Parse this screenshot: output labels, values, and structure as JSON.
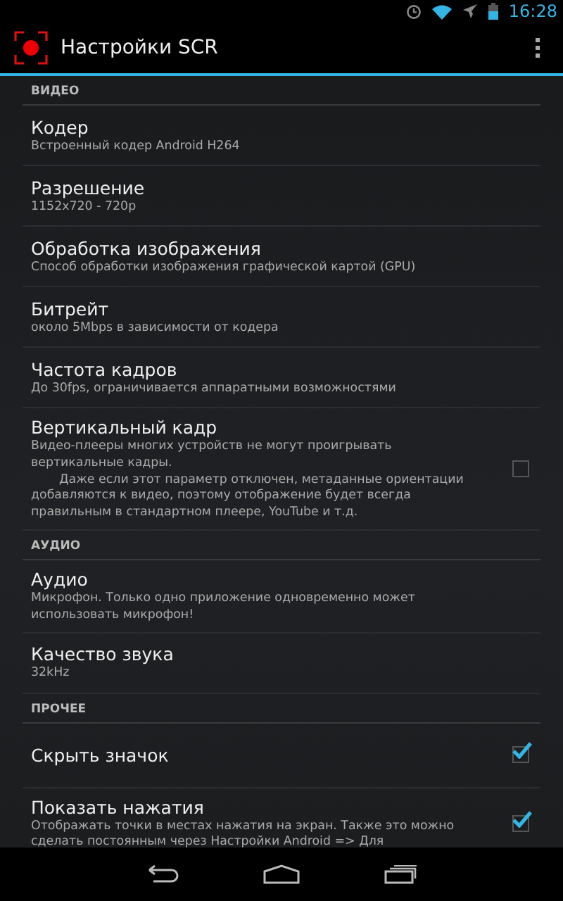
{
  "status_bar": {
    "time": "16:28"
  },
  "action_bar": {
    "title": "Настройки SCR"
  },
  "preferences": [
    {
      "kind": "header",
      "title": "ВИДЕО"
    },
    {
      "kind": "item",
      "title": "Кодер",
      "summary": [
        "Встроенный кодер Android H264"
      ]
    },
    {
      "kind": "item",
      "title": "Разрешение",
      "summary": [
        "1152x720 - 720p"
      ]
    },
    {
      "kind": "item",
      "title": "Обработка изображения",
      "summary": [
        "Способ обработки изображения графической картой (GPU)"
      ]
    },
    {
      "kind": "item",
      "title": "Битрейт",
      "summary": [
        "около 5Mbps в зависимости от кодера"
      ]
    },
    {
      "kind": "item",
      "title": "Частота кадров",
      "summary": [
        "До 30fps, ограничивается аппаратными возможностями"
      ]
    },
    {
      "kind": "check",
      "title": "Вертикальный кадр",
      "checked": false,
      "summary": [
        "Видео-плееры многих устройств не могут проигрывать вертикальные кадры.",
        "Даже если этот параметр отключен, метаданные ориентации добавляются к видео, поэтому отображение будет всегда правильным в стандартном плеере, YouTube и т.д."
      ]
    },
    {
      "kind": "header",
      "title": "АУДИО"
    },
    {
      "kind": "item",
      "title": "Аудио",
      "summary": [
        "Микрофон. Только одно приложение одновременно может использовать микрофон!"
      ]
    },
    {
      "kind": "item",
      "title": "Качество звука",
      "summary": [
        "32kHz"
      ]
    },
    {
      "kind": "header",
      "title": "ПРОЧЕЕ"
    },
    {
      "kind": "check",
      "title": "Скрыть значок",
      "checked": true
    },
    {
      "kind": "check",
      "title": "Показать нажатия",
      "checked": true,
      "summary": [
        "Отображать точки в местах нажатия на экран. Также это можно сделать постоянным через Настройки Android => Для"
      ]
    }
  ]
}
